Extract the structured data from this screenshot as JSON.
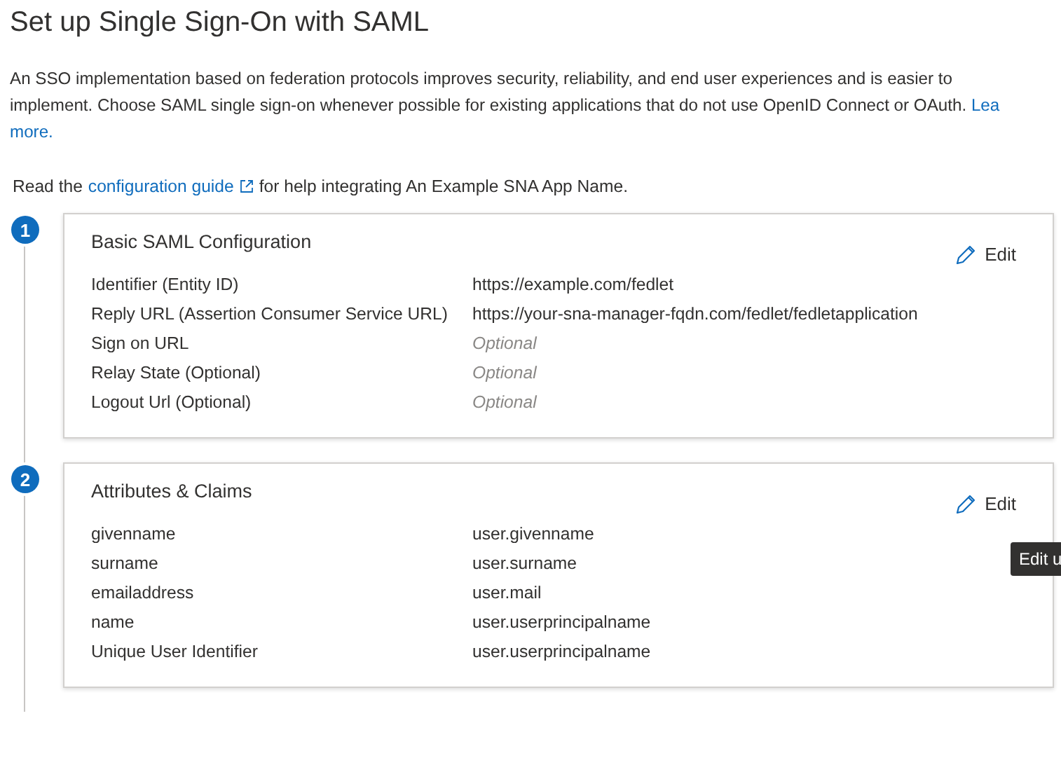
{
  "title": "Set up Single Sign-On with SAML",
  "intro": {
    "lines": [
      "An SSO implementation based on federation protocols improves security, reliability, and end user experiences and is easier to",
      "implement. Choose SAML single sign-on whenever possible for existing applications that do not use OpenID Connect or OAuth."
    ],
    "link_parts": [
      "Lea",
      "more."
    ]
  },
  "guide": {
    "before": "Read the",
    "link": "configuration guide",
    "after": "for help integrating An Example SNA App Name."
  },
  "steps": [
    {
      "number": "1",
      "title": "Basic SAML Configuration",
      "edit": "Edit",
      "rows": [
        {
          "label": "Identifier (Entity ID)",
          "value": "https://example.com/fedlet",
          "kind": "value"
        },
        {
          "label": "Reply URL (Assertion Consumer Service URL)",
          "value": "https://your-sna-manager-fqdn.com/fedlet/fedletapplication",
          "kind": "value"
        },
        {
          "label": "Sign on URL",
          "value": "Optional",
          "kind": "placeholder"
        },
        {
          "label": "Relay State (Optional)",
          "value": "Optional",
          "kind": "placeholder"
        },
        {
          "label": "Logout Url (Optional)",
          "value": "Optional",
          "kind": "placeholder"
        }
      ]
    },
    {
      "number": "2",
      "title": "Attributes & Claims",
      "edit": "Edit",
      "tooltip": "Edit u",
      "rows": [
        {
          "label": "givenname",
          "value": "user.givenname",
          "kind": "value"
        },
        {
          "label": "surname",
          "value": "user.surname",
          "kind": "value"
        },
        {
          "label": "emailaddress",
          "value": "user.mail",
          "kind": "value"
        },
        {
          "label": "name",
          "value": "user.userprincipalname",
          "kind": "value"
        },
        {
          "label": "Unique User Identifier",
          "value": "user.userprincipalname",
          "kind": "value"
        }
      ]
    }
  ]
}
